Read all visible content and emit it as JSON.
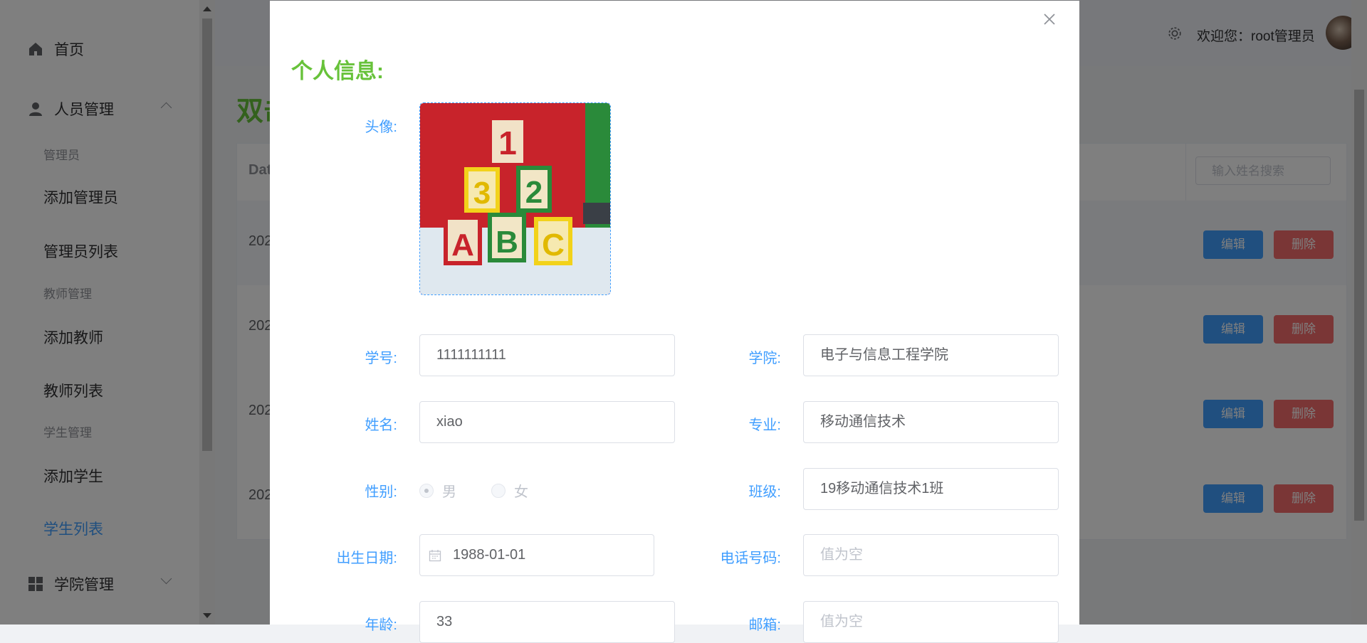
{
  "sidebar": {
    "home": "首页",
    "people": "人员管理",
    "groups": [
      {
        "title": "管理员",
        "items": [
          "添加管理员",
          "管理员列表"
        ]
      },
      {
        "title": "教师管理",
        "items": [
          "添加教师",
          "教师列表"
        ]
      },
      {
        "title": "学生管理",
        "items": [
          "添加学生",
          "学生列表"
        ]
      }
    ],
    "college": "学院管理",
    "active_item": "学生列表"
  },
  "header": {
    "welcome": "欢迎您：root管理员",
    "icons": [
      "gear-icon",
      "avatar"
    ]
  },
  "content": {
    "title_partial": "双击",
    "table": {
      "column_partial": "Dat",
      "search_placeholder": "输入姓名搜索",
      "rows": [
        {
          "date_partial": "202",
          "edit": "编辑",
          "delete": "删除"
        },
        {
          "date_partial": "202",
          "edit": "编辑",
          "delete": "删除"
        },
        {
          "date_partial": "202",
          "edit": "编辑",
          "delete": "删除"
        },
        {
          "date_partial": "202",
          "edit": "编辑",
          "delete": "删除"
        }
      ]
    }
  },
  "dialog": {
    "title": "个人信息:",
    "avatar_label": "头像:",
    "fields": {
      "student_id": {
        "label": "学号:",
        "value": "1111111111"
      },
      "college": {
        "label": "学院:",
        "value": "电子与信息工程学院"
      },
      "name": {
        "label": "姓名:",
        "value": "xiao"
      },
      "major": {
        "label": "专业:",
        "value": "移动通信技术"
      },
      "gender": {
        "label": "性别:",
        "options": [
          "男",
          "女"
        ],
        "selected": "男"
      },
      "class": {
        "label": "班级:",
        "value": "19移动通信技术1班"
      },
      "birthday": {
        "label": "出生日期:",
        "value": "1988-01-01"
      },
      "phone": {
        "label": "电话号码:",
        "placeholder": "值为空"
      },
      "age": {
        "label": "年龄:",
        "value": "33"
      },
      "email": {
        "label": "邮箱:",
        "placeholder": "值为空"
      }
    }
  },
  "colors": {
    "primary": "#409eff",
    "success": "#67c23a",
    "danger": "#f56c6c"
  }
}
